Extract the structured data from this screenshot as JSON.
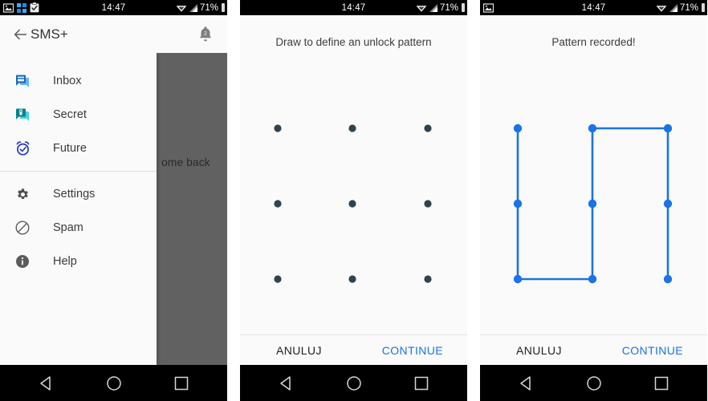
{
  "colors": {
    "accent_blue": "#1a73e8",
    "inbox_icon": "#1565c0",
    "secret_icon": "#00838f",
    "future_icon": "#2337c6",
    "dot_inactive": "#2f434f",
    "scrim": "#616161",
    "panel_bg": "#fafafa",
    "statusbar_bg": "#000000"
  },
  "statusbar": {
    "time": "14:47",
    "battery_pct": "71%",
    "left_icons": [
      "image-icon",
      "apps-grid-icon",
      "clipboard-check-icon"
    ],
    "right_icons": [
      "wifi-icon",
      "cell-signal-icon",
      "battery-icon"
    ]
  },
  "panel_drawer": {
    "appbar": {
      "back_icon": "arrow-back-icon",
      "title": "SMS+",
      "notification_icon": "bell-icon",
      "notification_badge": "2"
    },
    "scrim_text": "ome back",
    "items": [
      {
        "label": "Inbox",
        "icon": "chat-bubbles-icon"
      },
      {
        "label": "Secret",
        "icon": "chat-bubble-lock-icon"
      },
      {
        "label": "Future",
        "icon": "alarm-clock-check-icon"
      },
      {
        "label": "Settings",
        "icon": "gear-icon"
      },
      {
        "label": "Spam",
        "icon": "block-icon"
      },
      {
        "label": "Help",
        "icon": "info-icon"
      }
    ]
  },
  "panel_define": {
    "heading": "Draw to define an unlock pattern",
    "cancel_label": "ANULUJ",
    "continue_label": "CONTINUE",
    "dots": [
      {
        "row": 0,
        "col": 0,
        "active": false
      },
      {
        "row": 0,
        "col": 1,
        "active": false
      },
      {
        "row": 0,
        "col": 2,
        "active": false
      },
      {
        "row": 1,
        "col": 0,
        "active": false
      },
      {
        "row": 1,
        "col": 1,
        "active": false
      },
      {
        "row": 1,
        "col": 2,
        "active": false
      },
      {
        "row": 2,
        "col": 0,
        "active": false
      },
      {
        "row": 2,
        "col": 1,
        "active": false
      },
      {
        "row": 2,
        "col": 2,
        "active": false
      }
    ]
  },
  "panel_recorded": {
    "heading": "Pattern recorded!",
    "cancel_label": "ANULUJ",
    "continue_label": "CONTINUE",
    "pattern_path": [
      {
        "row": 0,
        "col": 0
      },
      {
        "row": 1,
        "col": 0
      },
      {
        "row": 2,
        "col": 0
      },
      {
        "row": 2,
        "col": 1
      },
      {
        "row": 1,
        "col": 1
      },
      {
        "row": 0,
        "col": 1
      },
      {
        "row": 0,
        "col": 2
      },
      {
        "row": 1,
        "col": 2
      },
      {
        "row": 2,
        "col": 2
      }
    ]
  },
  "navbar": {
    "back_label": "back-triangle-icon",
    "home_label": "home-circle-icon",
    "recents_label": "recents-square-icon"
  }
}
